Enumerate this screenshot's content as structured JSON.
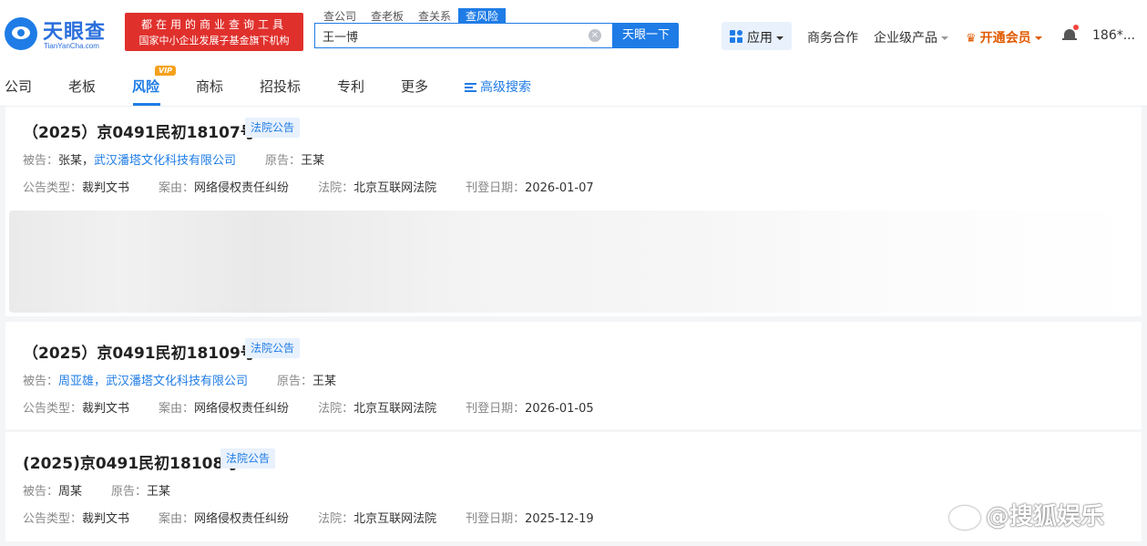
{
  "header": {
    "logo_title": "天眼查",
    "logo_sub": "TianYanCha.com",
    "slogan_line1": "都在用的商业查询工具",
    "slogan_line2": "国家中小企业发展子基金旗下机构",
    "search_tabs": [
      "查公司",
      "查老板",
      "查关系",
      "查风险"
    ],
    "active_search_tab": "查风险",
    "search_value": "王一博",
    "search_button": "天眼一下",
    "apps_label": "应用",
    "business": "商务合作",
    "enterprise": "企业级产品",
    "vip": "开通会员",
    "user": "186*..."
  },
  "nav": {
    "items": [
      "公司",
      "老板",
      "风险",
      "商标",
      "招投标",
      "专利",
      "更多"
    ],
    "active": "风险",
    "vip_badge": "VIP",
    "advanced_search": "高级搜索"
  },
  "labels": {
    "defendant": "被告：",
    "plaintiff": "原告：",
    "notice_type": "公告类型：",
    "cause": "案由：",
    "court": "法院：",
    "publish_date": "刊登日期："
  },
  "cases": [
    {
      "title": "（2025）京0491民初18107号",
      "tag": "法院公告",
      "defendants_plain": "张某，",
      "defendants_link": "武汉潘塔文化科技有限公司",
      "plaintiff": "王某",
      "notice_type": "裁判文书",
      "cause": "网络侵权责任纠纷",
      "court": "北京互联网法院",
      "date": "2026-01-07"
    },
    {
      "title": "（2025）京0491民初18109号",
      "tag": "法院公告",
      "defendants_plain": "",
      "defendants_link": "周亚雄，武汉潘塔文化科技有限公司",
      "plaintiff": "王某",
      "notice_type": "裁判文书",
      "cause": "网络侵权责任纠纷",
      "court": "北京互联网法院",
      "date": "2026-01-05"
    },
    {
      "title": "(2025)京0491民初18108号",
      "tag": "法院公告",
      "defendants_plain": "周某",
      "defendants_link": "",
      "plaintiff": "王某",
      "notice_type": "裁判文书",
      "cause": "网络侵权责任纠纷",
      "court": "北京互联网法院",
      "date": "2025-12-19"
    }
  ],
  "watermark": "@搜狐娱乐",
  "colors": {
    "brand_blue": "#1f7ce6",
    "slogan_red": "#e0302c",
    "vip_orange": "#e05a00"
  }
}
